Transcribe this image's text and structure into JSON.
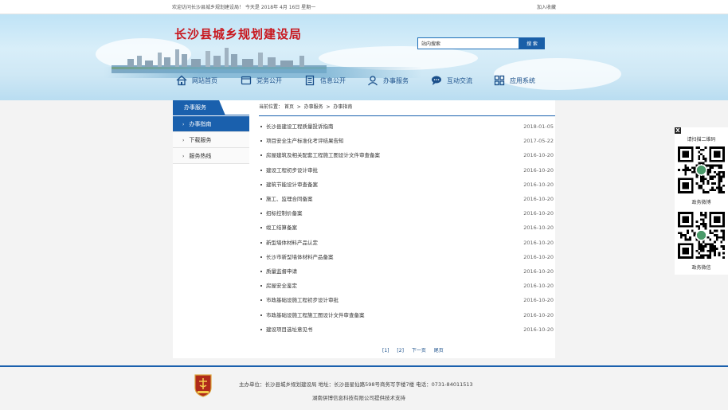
{
  "topbar": {
    "welcome": "欢迎访问长沙县城乡规划建设局！ 今天是 2018年 4月 16日 星期一",
    "favorite": "加入收藏"
  },
  "header": {
    "site_title": "长沙县城乡规划建设局",
    "search_placeholder": "站内搜索",
    "search_button": "搜 索"
  },
  "nav": [
    {
      "label": "网站首页",
      "icon": "home-icon"
    },
    {
      "label": "党务公开",
      "icon": "folder-icon"
    },
    {
      "label": "信息公开",
      "icon": "document-icon"
    },
    {
      "label": "办事服务",
      "icon": "user-icon"
    },
    {
      "label": "互动交流",
      "icon": "chat-icon"
    },
    {
      "label": "应用系统",
      "icon": "grid-icon"
    }
  ],
  "sidebar": {
    "header": "办事服务",
    "items": [
      {
        "label": "办事指南",
        "active": true
      },
      {
        "label": "下载服务",
        "active": false
      },
      {
        "label": "服务热线",
        "active": false
      }
    ]
  },
  "breadcrumb": {
    "prefix": "当前位置：",
    "parts": [
      "首页",
      "办事服务",
      "办事指南"
    ],
    "sep": ">"
  },
  "list": [
    {
      "title": "长沙县建设工程质量投诉指南",
      "date": "2018-01-05"
    },
    {
      "title": "项目安全生产标准化考评结果告知",
      "date": "2017-05-22"
    },
    {
      "title": "房屋建筑及相关配套工程施工图设计文件审查备案",
      "date": "2016-10-20"
    },
    {
      "title": "建设工程初步设计审批",
      "date": "2016-10-20"
    },
    {
      "title": "建筑节能设计审查备案",
      "date": "2016-10-20"
    },
    {
      "title": "施工、监理合同备案",
      "date": "2016-10-20"
    },
    {
      "title": "招标控制价备案",
      "date": "2016-10-20"
    },
    {
      "title": "竣工结算备案",
      "date": "2016-10-20"
    },
    {
      "title": "新型墙体材料产品认定",
      "date": "2016-10-20"
    },
    {
      "title": "长沙市新型墙体材料产品备案",
      "date": "2016-10-20"
    },
    {
      "title": "质量监督申请",
      "date": "2016-10-20"
    },
    {
      "title": "房屋安全鉴定",
      "date": "2016-10-20"
    },
    {
      "title": "市政基础设施工程初步设计审批",
      "date": "2016-10-20"
    },
    {
      "title": "市政基础设施工程施工图设计文件审查备案",
      "date": "2016-10-20"
    },
    {
      "title": "建设项目选址意见书",
      "date": "2016-10-20"
    }
  ],
  "pager": {
    "pages": [
      "[1]",
      "[2]"
    ],
    "next": "下一页",
    "last": "尾页"
  },
  "qr": {
    "close": "X",
    "header": "请扫描二维码",
    "weibo": "政务微博",
    "wechat": "政务微信"
  },
  "footer": {
    "line1": "主办单位：长沙县城乡规划建设局      地址：长沙县星仙路598号商务写字楼7楼      电话：0731-84011513",
    "line2": "湖南併博信息科技有限公司提供技术支持"
  },
  "colors": {
    "accent": "#1a60ad",
    "title_red": "#c8161d"
  }
}
